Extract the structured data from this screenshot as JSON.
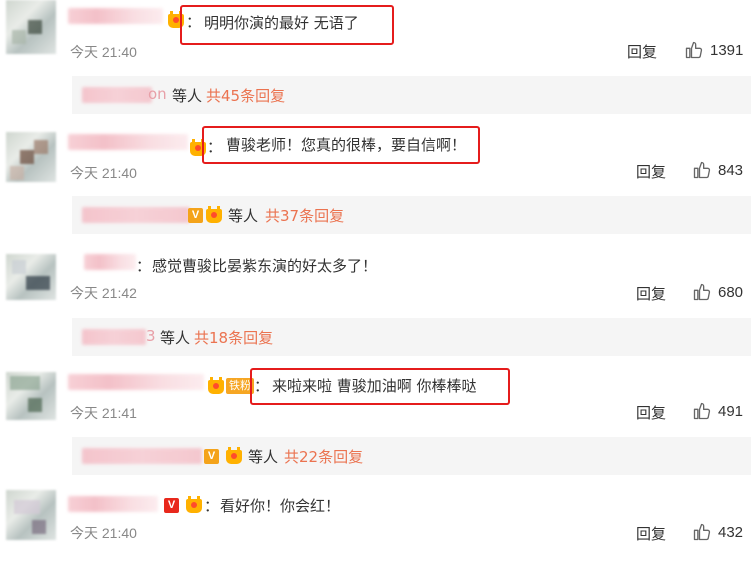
{
  "comments": [
    {
      "text": "明明你演的最好 无语了",
      "time": "今天 21:40",
      "reply_label": "回复",
      "likes": "1391",
      "sub": {
        "name_tail": "on",
        "etc": "等人",
        "more": "共45条回复"
      }
    },
    {
      "text": "曹骏老师！您真的很棒，要自信啊！",
      "time": "今天 21:40",
      "reply_label": "回复",
      "likes": "843",
      "sub": {
        "name_tail": "V",
        "etc": "等人",
        "more": "共37条回复"
      }
    },
    {
      "text": "感觉曹骏比晏紫东演的好太多了！",
      "time": "今天 21:42",
      "reply_label": "回复",
      "likes": "680",
      "sub": {
        "name_tail": "3",
        "etc": "等人",
        "more": "共18条回复"
      }
    },
    {
      "text": "来啦来啦 曹骏加油啊 你棒棒哒",
      "time": "今天 21:41",
      "reply_label": "回复",
      "likes": "491",
      "sub": {
        "name_tail": "V",
        "etc": "等人",
        "more": "共22条回复"
      }
    },
    {
      "text": "看好你！你会红！",
      "time": "今天 21:40",
      "reply_label": "回复",
      "likes": "432"
    }
  ],
  "badges": {
    "fan_label": "铁粉",
    "v_label": "V"
  },
  "colors": {
    "highlight": "#e51c1c",
    "link": "#eb7350",
    "subbar": "#f5f5f5"
  }
}
